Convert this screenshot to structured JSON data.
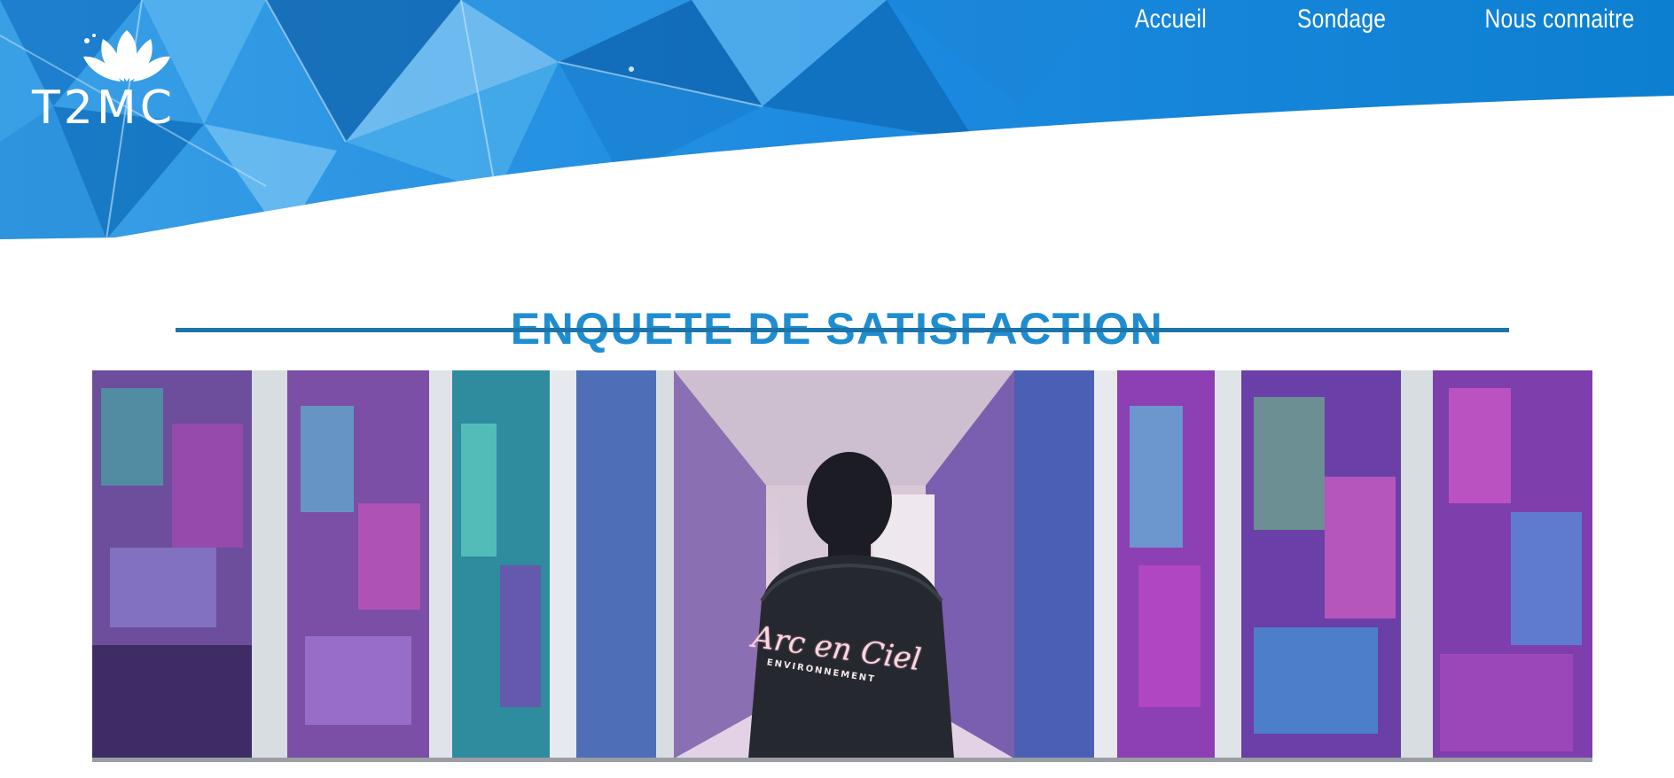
{
  "brand": {
    "logo_text": "T2MC"
  },
  "nav": {
    "items": [
      {
        "label": "Accueil"
      },
      {
        "label": "Sondage"
      },
      {
        "label": "Nous connaitre"
      }
    ]
  },
  "main": {
    "title": "ENQUETE DE SATISFACTION",
    "hero": {
      "jacket_text": "Arc en Ciel",
      "jacket_subtext": "ENVIRONNEMENT"
    }
  },
  "colors": {
    "banner_blue": "#0d7fd0",
    "title_blue": "#1f8dd0",
    "rule_blue": "#1c74a8"
  }
}
